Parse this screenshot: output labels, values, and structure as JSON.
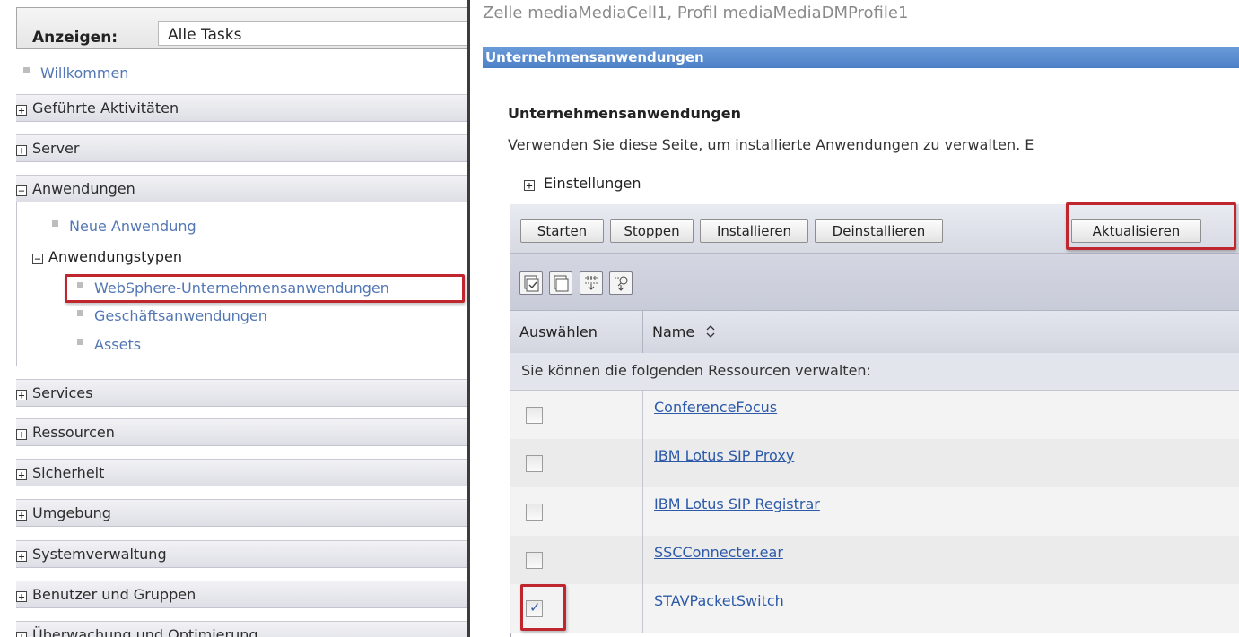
{
  "nav": {
    "show_label": "Anzeigen:",
    "show_value": "Alle Tasks",
    "welcome": "Willkommen",
    "categories": [
      {
        "label": "Geführte Aktivitäten",
        "toggle": "+"
      },
      {
        "label": "Server",
        "toggle": "+"
      },
      {
        "label": "Anwendungen",
        "toggle": "−"
      },
      {
        "label": "Services",
        "toggle": "+"
      },
      {
        "label": "Ressourcen",
        "toggle": "+"
      },
      {
        "label": "Sicherheit",
        "toggle": "+"
      },
      {
        "label": "Umgebung",
        "toggle": "+"
      },
      {
        "label": "Systemverwaltung",
        "toggle": "+"
      },
      {
        "label": "Benutzer und Gruppen",
        "toggle": "+"
      },
      {
        "label": "Überwachung und Optimierung",
        "toggle": "+"
      }
    ],
    "apps": {
      "new_app": "Neue Anwendung",
      "app_types": "Anwendungstypen",
      "app_types_toggle": "−",
      "types": [
        "WebSphere-Unternehmensanwendungen",
        "Geschäftsanwendungen",
        "Assets"
      ]
    }
  },
  "main": {
    "breadcrumb": "Zelle mediaMediaCell1, Profil mediaMediaDMProfile1",
    "panel_title": "Unternehmensanwendungen",
    "heading": "Unternehmensanwendungen",
    "description": "Verwenden Sie diese Seite, um installierte Anwendungen zu verwalten. E",
    "preferences": "Einstellungen",
    "preferences_toggle": "+",
    "buttons": [
      "Starten",
      "Stoppen",
      "Installieren",
      "Deinstallieren",
      "Aktualisieren"
    ],
    "icons": [
      "select-all-icon",
      "deselect-all-icon",
      "expand-filter-icon",
      "show-filter-icon"
    ],
    "columns": {
      "select": "Auswählen",
      "name": "Name"
    },
    "info": "Sie können die folgenden Ressourcen verwalten:",
    "rows": [
      {
        "name": "ConferenceFocus",
        "checked": false
      },
      {
        "name": "IBM Lotus SIP Proxy",
        "checked": false
      },
      {
        "name": "IBM Lotus SIP Registrar",
        "checked": false
      },
      {
        "name": "SSCConnecter.ear",
        "checked": false
      },
      {
        "name": "STAVPacketSwitch",
        "checked": true
      }
    ]
  },
  "colors": {
    "highlight": "#c0262d",
    "titlebar": "#4c80c6",
    "link": "#2d5aa8",
    "nav_link": "#5277b4"
  }
}
